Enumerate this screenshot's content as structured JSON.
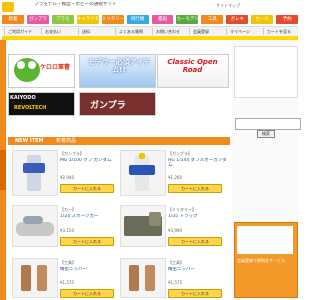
{
  "header": {
    "tagline": "プラモデル・模型・ホビーの通販サイト",
    "links": "サイトマップ"
  },
  "colors": {
    "accent": "#f08a1c",
    "nav": [
      "#f08a1c",
      "#e85aa0",
      "#8dc63f",
      "#f2c300",
      "#f08a1c",
      "#37a8e0",
      "#e85aa0",
      "#5aa83a",
      "#f08a1c",
      "#e34b2b",
      "#f2c300",
      "#e34b2b"
    ]
  },
  "nav": {
    "categories": [
      "新着",
      "ガンプラ",
      "プラモ",
      "キャラクター",
      "ミリタリー",
      "飛行機",
      "艦船",
      "カーモデル",
      "工具",
      "ガレキ",
      "セール",
      "予約"
    ]
  },
  "subnav": {
    "items": [
      "ご利用ガイド",
      "お支払い",
      "送料",
      "よくある質問",
      "お問い合わせ",
      "会員登録",
      "マイページ",
      "カートを見る"
    ]
  },
  "banners": {
    "b1": "ケロロ軍曹",
    "b2": "モデラー必須アイテム!!",
    "b3": "Classic Open Road",
    "b4_line1": "KAIYODO",
    "b4_line2": "REVOLTECH",
    "b5": "ガンプラ"
  },
  "search": {
    "placeholder": "",
    "button": "検索"
  },
  "new_item": {
    "title": "NEW ITEM",
    "subtitle": "新着商品"
  },
  "products": [
    {
      "category": "【ガンプラ】",
      "name": "MG 1/100 グフ ガンダム",
      "price": "¥2,940",
      "cart": "カートに入れる"
    },
    {
      "category": "【ガンプラ】",
      "name": "HG 1/144 ダブルオーガンダム",
      "price": "¥1,260",
      "cart": "カートに入れる"
    },
    {
      "category": "【カー】",
      "name": "1/24 スポーツカー",
      "price": "¥3,150",
      "cart": "カートに入れる"
    },
    {
      "category": "【ミリタリー】",
      "name": "1/35 トラック",
      "price": "¥3,990",
      "cart": "カートに入れる"
    },
    {
      "category": "【工具】",
      "name": "精密ニッパー",
      "price": "¥1,575",
      "cart": "カートに入れる"
    },
    {
      "category": "【工具】",
      "name": "精密ニッパー",
      "price": "¥1,575",
      "cart": "カートに入れる"
    }
  ],
  "right_promo": {
    "text": "会員登録で便利なサービス"
  }
}
